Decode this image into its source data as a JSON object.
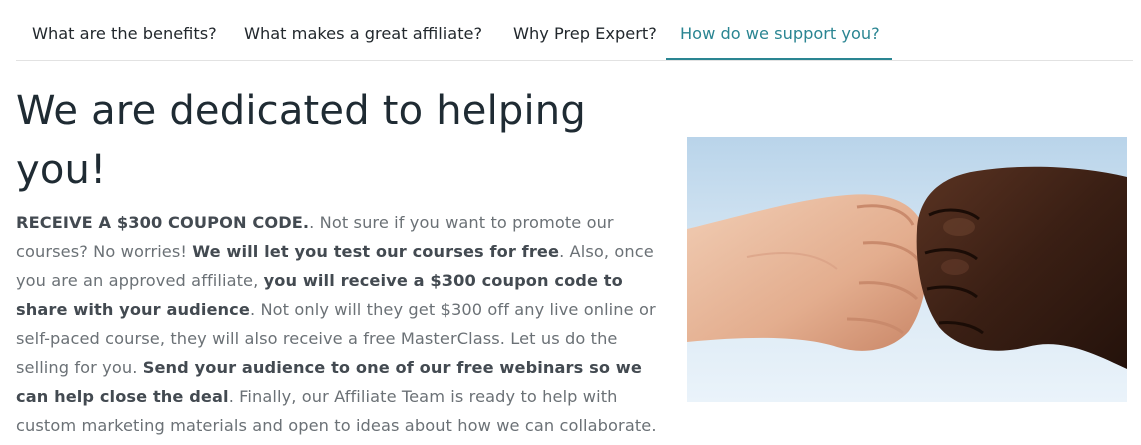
{
  "tabs": [
    {
      "label": "What are the benefits?",
      "active": false
    },
    {
      "label": "What makes a great affiliate?",
      "active": false
    },
    {
      "label": "Why Prep Expert?",
      "active": false
    },
    {
      "label": "How do we support you?",
      "active": true
    }
  ],
  "colors": {
    "accent": "#2a8592",
    "heading": "#1f2b33",
    "body_text": "#6b7176",
    "bold_text": "#434a51"
  },
  "content": {
    "headline": "We are dedicated to helping you!",
    "paragraph": [
      {
        "text": "RECEIVE A $300 COUPON CODE.",
        "bold": true
      },
      {
        "text": ". Not sure if you want to promote our courses? No worries! ",
        "bold": false
      },
      {
        "text": "We will let you test our courses for free",
        "bold": true
      },
      {
        "text": ". Also, once you are an approved affiliate, ",
        "bold": false
      },
      {
        "text": "you will receive a $300 coupon code to share with your audience",
        "bold": true
      },
      {
        "text": ". Not only will they get $300 off any live online or self-paced course, they will also receive a free MasterClass. Let us do the selling for you. ",
        "bold": false
      },
      {
        "text": "Send your audience to one of our free webinars so we can help close the deal",
        "bold": true
      },
      {
        "text": ". Finally, our Affiliate Team is ready to help with custom marketing materials and open to ideas about how we can collaborate.",
        "bold": false
      }
    ]
  },
  "image": {
    "icon": "fist-bump-photo"
  }
}
